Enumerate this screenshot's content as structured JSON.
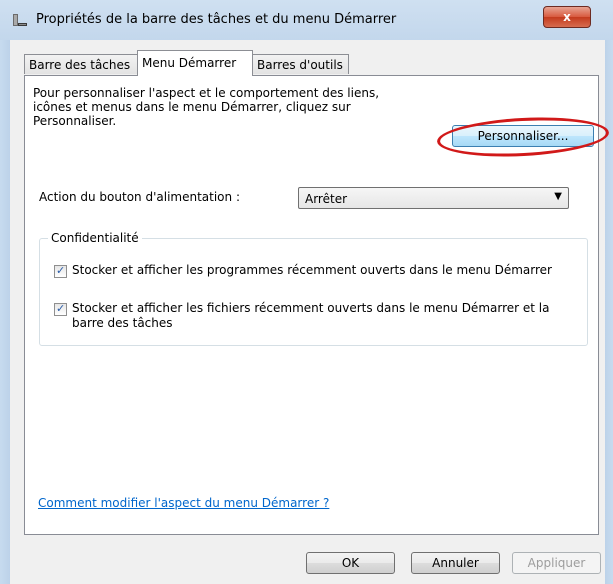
{
  "window": {
    "title": "Propriétés de la barre des tâches et du menu Démarrer",
    "close_label": "x"
  },
  "tabs": [
    {
      "label": "Barre des tâches"
    },
    {
      "label": "Menu Démarrer"
    },
    {
      "label": "Barres d'outils"
    }
  ],
  "panel": {
    "intro_text": "Pour personnaliser l'aspect et le comportement des liens, icônes et menus dans le menu Démarrer, cliquez sur Personnaliser.",
    "customize_button": "Personnaliser...",
    "power_label": "Action du bouton d'alimentation :",
    "power_value": "Arrêter",
    "privacy": {
      "legend": "Confidentialité",
      "option1": "Stocker et afficher les programmes récemment ouverts dans le menu Démarrer",
      "option2": "Stocker et afficher les fichiers récemment ouverts dans le menu Démarrer et la barre des tâches",
      "option1_checked": true,
      "option2_checked": true
    },
    "help_link": "Comment modifier l'aspect du menu Démarrer ?"
  },
  "buttons": {
    "ok": "OK",
    "cancel": "Annuler",
    "apply": "Appliquer"
  },
  "colors": {
    "annotation_ring": "#d11919",
    "link": "#0066cc"
  }
}
